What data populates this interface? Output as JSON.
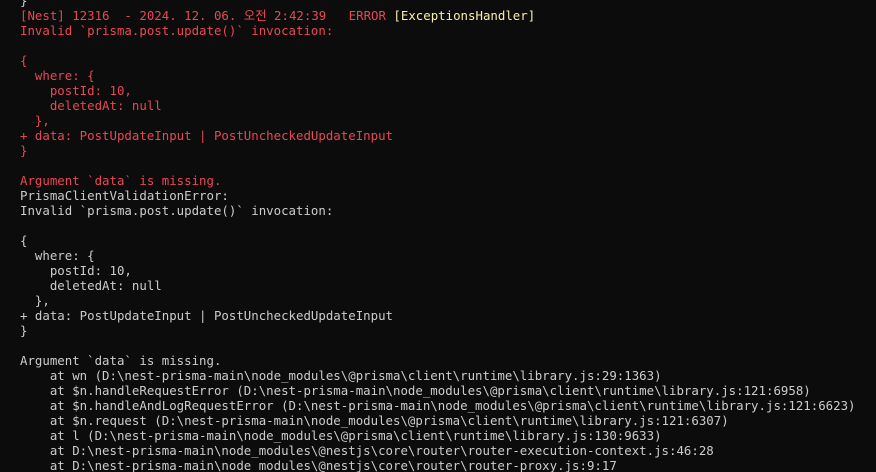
{
  "terminal": {
    "colors": {
      "background": "#0c0c0c",
      "foreground": "#cccccc",
      "error_red": "#e74856",
      "context_yellow": "#f9f1a5"
    },
    "lines": [
      [
        {
          "text": "}",
          "color": "white"
        }
      ],
      [
        {
          "text": "[Nest] 12316  - 2024. 12. 06. 오전 2:42:39   ",
          "color": "red"
        },
        {
          "text": "ERROR ",
          "color": "red"
        },
        {
          "text": "[ExceptionsHandler]",
          "color": "yellow"
        }
      ],
      [
        {
          "text": "Invalid `prisma.post.update()` invocation:",
          "color": "red"
        }
      ],
      [
        {
          "text": "",
          "color": "red"
        }
      ],
      [
        {
          "text": "{",
          "color": "red"
        }
      ],
      [
        {
          "text": "  where: {",
          "color": "red"
        }
      ],
      [
        {
          "text": "    postId: 10,",
          "color": "red"
        }
      ],
      [
        {
          "text": "    deletedAt: null",
          "color": "red"
        }
      ],
      [
        {
          "text": "  },",
          "color": "red"
        }
      ],
      [
        {
          "text": "+ data: PostUpdateInput | PostUncheckedUpdateInput",
          "color": "red"
        }
      ],
      [
        {
          "text": "}",
          "color": "red"
        }
      ],
      [
        {
          "text": "",
          "color": "red"
        }
      ],
      [
        {
          "text": "Argument `data` is missing.",
          "color": "red"
        }
      ],
      [
        {
          "text": "PrismaClientValidationError:",
          "color": "white"
        }
      ],
      [
        {
          "text": "Invalid `prisma.post.update()` invocation:",
          "color": "white"
        }
      ],
      [
        {
          "text": "",
          "color": "white"
        }
      ],
      [
        {
          "text": "{",
          "color": "white"
        }
      ],
      [
        {
          "text": "  where: {",
          "color": "white"
        }
      ],
      [
        {
          "text": "    postId: 10,",
          "color": "white"
        }
      ],
      [
        {
          "text": "    deletedAt: null",
          "color": "white"
        }
      ],
      [
        {
          "text": "  },",
          "color": "white"
        }
      ],
      [
        {
          "text": "+ data: PostUpdateInput | PostUncheckedUpdateInput",
          "color": "white"
        }
      ],
      [
        {
          "text": "}",
          "color": "white"
        }
      ],
      [
        {
          "text": "",
          "color": "white"
        }
      ],
      [
        {
          "text": "Argument `data` is missing.",
          "color": "white"
        }
      ],
      [
        {
          "text": "    at wn (D:\\nest-prisma-main\\node_modules\\@prisma\\client\\runtime\\library.js:29:1363)",
          "color": "white"
        }
      ],
      [
        {
          "text": "    at $n.handleRequestError (D:\\nest-prisma-main\\node_modules\\@prisma\\client\\runtime\\library.js:121:6958)",
          "color": "white"
        }
      ],
      [
        {
          "text": "    at $n.handleAndLogRequestError (D:\\nest-prisma-main\\node_modules\\@prisma\\client\\runtime\\library.js:121:6623)",
          "color": "white"
        }
      ],
      [
        {
          "text": "    at $n.request (D:\\nest-prisma-main\\node_modules\\@prisma\\client\\runtime\\library.js:121:6307)",
          "color": "white"
        }
      ],
      [
        {
          "text": "    at l (D:\\nest-prisma-main\\node_modules\\@prisma\\client\\runtime\\library.js:130:9633)",
          "color": "white"
        }
      ],
      [
        {
          "text": "    at D:\\nest-prisma-main\\node_modules\\@nestjs\\core\\router\\router-execution-context.js:46:28",
          "color": "white"
        }
      ],
      [
        {
          "text": "    at D:\\nest-prisma-main\\node_modules\\@nestjs\\core\\router\\router-proxy.js:9:17",
          "color": "white"
        }
      ]
    ]
  }
}
